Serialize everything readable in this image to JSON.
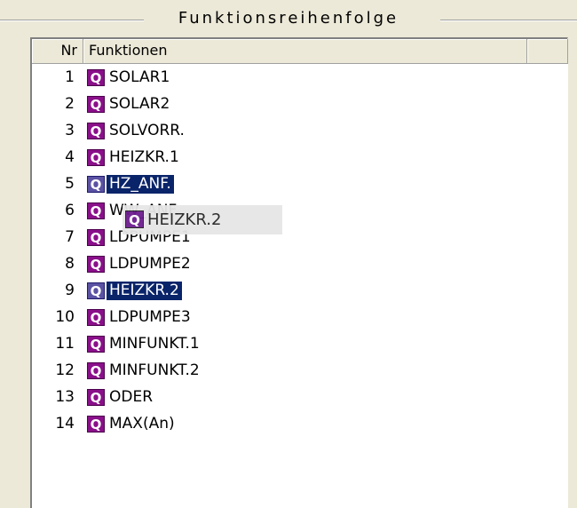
{
  "group": {
    "title": "Funktionsreihenfolge"
  },
  "columns": {
    "nr": "Nr",
    "functions": "Funktionen"
  },
  "icon_glyph": "Q",
  "rows": [
    {
      "nr": "1",
      "label": "SOLAR1"
    },
    {
      "nr": "2",
      "label": "SOLAR2"
    },
    {
      "nr": "3",
      "label": "SOLVORR."
    },
    {
      "nr": "4",
      "label": "HEIZKR.1"
    },
    {
      "nr": "5",
      "label": "HZ_ANF."
    },
    {
      "nr": "6",
      "label": "WW_ANF."
    },
    {
      "nr": "7",
      "label": "LDPUMPE1"
    },
    {
      "nr": "8",
      "label": "LDPUMPE2"
    },
    {
      "nr": "9",
      "label": "HEIZKR.2"
    },
    {
      "nr": "10",
      "label": "LDPUMPE3"
    },
    {
      "nr": "11",
      "label": "MINFUNKT.1"
    },
    {
      "nr": "12",
      "label": "MINFUNKT.2"
    },
    {
      "nr": "13",
      "label": "ODER"
    },
    {
      "nr": "14",
      "label": "MAX(An)"
    }
  ],
  "drag": {
    "label": "HEIZKR.2"
  },
  "colors": {
    "icon": "#8a0f8a",
    "selection": "#0a246a",
    "window": "#ece9d8"
  }
}
